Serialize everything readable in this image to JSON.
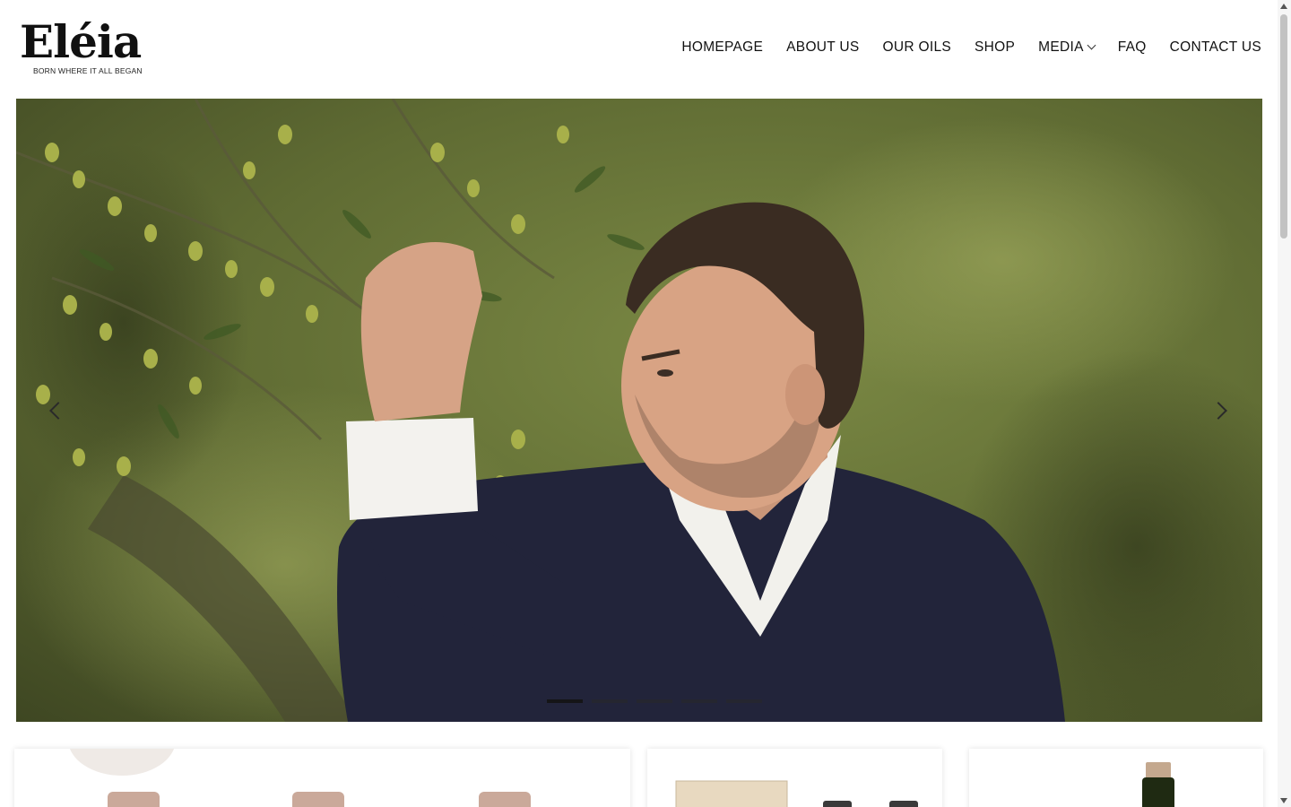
{
  "brand": {
    "name": "Eléia",
    "tagline": "BORN WHERE IT ALL BEGAN"
  },
  "nav": {
    "items": [
      {
        "label": "HOMEPAGE"
      },
      {
        "label": "ABOUT US"
      },
      {
        "label": "OUR OILS"
      },
      {
        "label": "SHOP"
      },
      {
        "label": "MEDIA",
        "has_dropdown": true
      },
      {
        "label": "FAQ"
      },
      {
        "label": "CONTACT US"
      }
    ]
  },
  "hero": {
    "image": "man-inspecting-olive-branch-photo",
    "slides_count": 5,
    "active_slide": 1
  },
  "product_cards": [
    {
      "image": "three-bottles-photo"
    },
    {
      "image": "gift-box-and-bottles-photo"
    },
    {
      "image": "single-bottle-photo"
    }
  ],
  "colors": {
    "text": "#111111",
    "background": "#ffffff",
    "olive_green": "#6b7a2e"
  }
}
